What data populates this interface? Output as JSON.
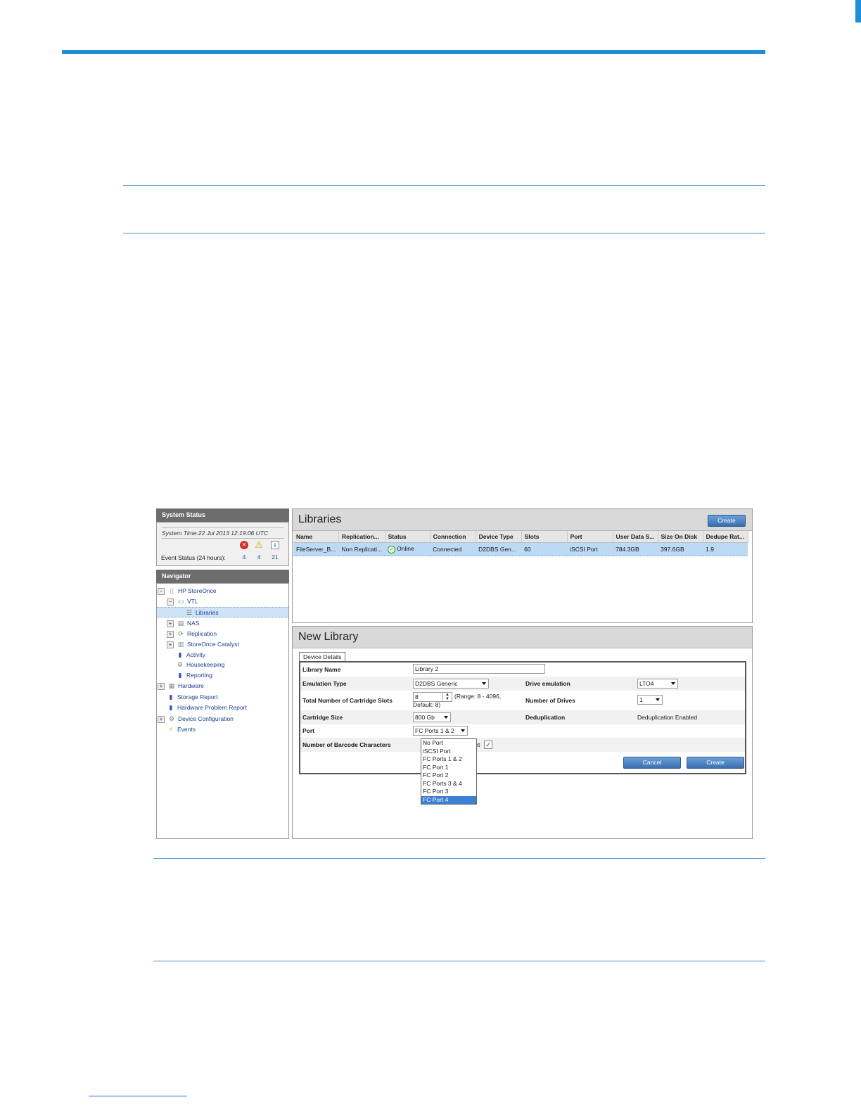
{
  "system_status": {
    "title": "System Status",
    "system_time": "System Time:22 Jul 2013 12:19:06 UTC",
    "event_label": "Event Status (24 hours):",
    "errors": "4",
    "warnings": "4",
    "info": "21"
  },
  "navigator": {
    "title": "Navigator",
    "items": [
      {
        "label": "HP StoreOnce"
      },
      {
        "label": "VTL"
      },
      {
        "label": "Libraries"
      },
      {
        "label": "NAS"
      },
      {
        "label": "Replication"
      },
      {
        "label": "StoreOnce Catalyst"
      },
      {
        "label": "Activity"
      },
      {
        "label": "Housekeeping"
      },
      {
        "label": "Reporting"
      },
      {
        "label": "Hardware"
      },
      {
        "label": "Storage Report"
      },
      {
        "label": "Hardware Problem Report"
      },
      {
        "label": "Device Configuration"
      },
      {
        "label": "Events"
      }
    ]
  },
  "libraries": {
    "title": "Libraries",
    "create_label": "Create",
    "columns": [
      "Name",
      "Replication...",
      "Status",
      "Connection",
      "Device Type",
      "Slots",
      "Port",
      "User Data S...",
      "Size On Disk",
      "Dedupe Rat..."
    ],
    "rows": [
      [
        "FileServer_B...",
        "Non Replicati...",
        "Online",
        "Connected",
        "D2DBS Gen...",
        "60",
        "iSCSI Port",
        "784.3GB",
        "397.6GB",
        "1.9"
      ]
    ]
  },
  "new_library": {
    "title": "New Library",
    "tab": "Device Details",
    "library_name_label": "Library Name",
    "library_name_value": "Library 2",
    "emulation_label": "Emulation Type",
    "emulation_value": "D2DBS Generic",
    "drive_emulation_label": "Drive emulation",
    "drive_emulation_value": "LTO4",
    "slots_label": "Total Number of Cartridge Slots",
    "slots_value": "8",
    "slots_range": "(Range: 8 - 4096,",
    "slots_default": "Default: 8)",
    "drives_label": "Number of Drives",
    "drives_value": "1",
    "cartridge_label": "Cartridge Size",
    "cartridge_value": "800 Gb",
    "dedupe_label": "Deduplication",
    "dedupe_value": "Deduplication Enabled",
    "port_label": "Port",
    "port_value": "FC Ports 1 & 2",
    "barcode_label": "Number of Barcode Characters",
    "barcode_value": "Eight",
    "port_options": [
      "No Port",
      "iSCSI Port",
      "FC Ports 1 & 2",
      "FC Port 1",
      "FC Port 2",
      "FC Ports 3 & 4",
      "FC Port 3",
      "FC Port 4"
    ],
    "cancel_label": "Cancel",
    "create_label": "Create"
  }
}
